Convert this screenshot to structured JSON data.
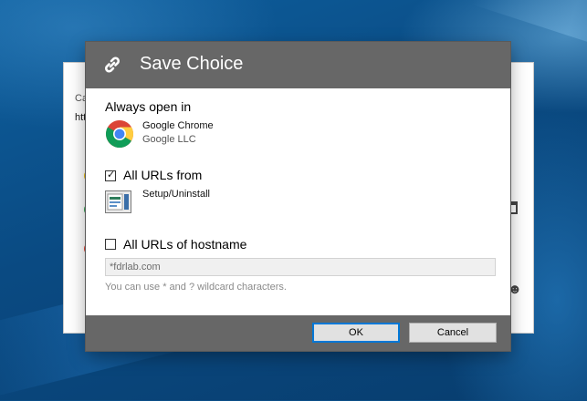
{
  "dialog": {
    "title": "Save Choice",
    "always_open_label": "Always open in",
    "app": {
      "name": "Google Chrome",
      "publisher": "Google LLC"
    },
    "all_urls_from": {
      "label": "All URLs from",
      "checked": true
    },
    "program": {
      "name": "Setup/Uninstall"
    },
    "all_urls_hostname": {
      "label": "All URLs of hostname",
      "checked": false
    },
    "hostname_input": {
      "value": "*fdrlab.com"
    },
    "hint": "You can use * and ? wildcard characters.",
    "ok_label": "OK",
    "cancel_label": "Cancel"
  },
  "background_window": {
    "row1_fragment": "Ca",
    "row2_fragment": "http"
  },
  "colors": {
    "titlebar": "#676767",
    "footer": "#676767",
    "accent": "#0078d7"
  },
  "icons": {
    "title": "link-icon",
    "app": "chrome-icon",
    "program": "program-icon"
  }
}
